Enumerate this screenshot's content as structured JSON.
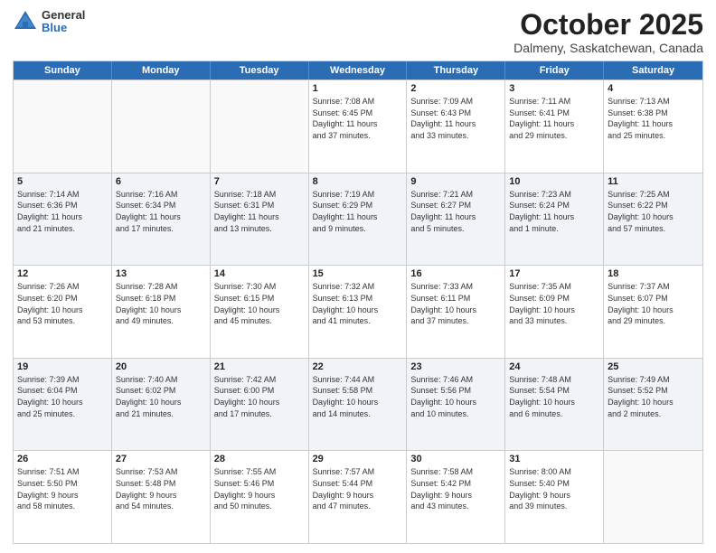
{
  "logo": {
    "general": "General",
    "blue": "Blue"
  },
  "title": "October 2025",
  "location": "Dalmeny, Saskatchewan, Canada",
  "weekdays": [
    "Sunday",
    "Monday",
    "Tuesday",
    "Wednesday",
    "Thursday",
    "Friday",
    "Saturday"
  ],
  "rows": [
    {
      "alt": false,
      "cells": [
        {
          "date": "",
          "info": ""
        },
        {
          "date": "",
          "info": ""
        },
        {
          "date": "",
          "info": ""
        },
        {
          "date": "1",
          "info": "Sunrise: 7:08 AM\nSunset: 6:45 PM\nDaylight: 11 hours\nand 37 minutes."
        },
        {
          "date": "2",
          "info": "Sunrise: 7:09 AM\nSunset: 6:43 PM\nDaylight: 11 hours\nand 33 minutes."
        },
        {
          "date": "3",
          "info": "Sunrise: 7:11 AM\nSunset: 6:41 PM\nDaylight: 11 hours\nand 29 minutes."
        },
        {
          "date": "4",
          "info": "Sunrise: 7:13 AM\nSunset: 6:38 PM\nDaylight: 11 hours\nand 25 minutes."
        }
      ]
    },
    {
      "alt": true,
      "cells": [
        {
          "date": "5",
          "info": "Sunrise: 7:14 AM\nSunset: 6:36 PM\nDaylight: 11 hours\nand 21 minutes."
        },
        {
          "date": "6",
          "info": "Sunrise: 7:16 AM\nSunset: 6:34 PM\nDaylight: 11 hours\nand 17 minutes."
        },
        {
          "date": "7",
          "info": "Sunrise: 7:18 AM\nSunset: 6:31 PM\nDaylight: 11 hours\nand 13 minutes."
        },
        {
          "date": "8",
          "info": "Sunrise: 7:19 AM\nSunset: 6:29 PM\nDaylight: 11 hours\nand 9 minutes."
        },
        {
          "date": "9",
          "info": "Sunrise: 7:21 AM\nSunset: 6:27 PM\nDaylight: 11 hours\nand 5 minutes."
        },
        {
          "date": "10",
          "info": "Sunrise: 7:23 AM\nSunset: 6:24 PM\nDaylight: 11 hours\nand 1 minute."
        },
        {
          "date": "11",
          "info": "Sunrise: 7:25 AM\nSunset: 6:22 PM\nDaylight: 10 hours\nand 57 minutes."
        }
      ]
    },
    {
      "alt": false,
      "cells": [
        {
          "date": "12",
          "info": "Sunrise: 7:26 AM\nSunset: 6:20 PM\nDaylight: 10 hours\nand 53 minutes."
        },
        {
          "date": "13",
          "info": "Sunrise: 7:28 AM\nSunset: 6:18 PM\nDaylight: 10 hours\nand 49 minutes."
        },
        {
          "date": "14",
          "info": "Sunrise: 7:30 AM\nSunset: 6:15 PM\nDaylight: 10 hours\nand 45 minutes."
        },
        {
          "date": "15",
          "info": "Sunrise: 7:32 AM\nSunset: 6:13 PM\nDaylight: 10 hours\nand 41 minutes."
        },
        {
          "date": "16",
          "info": "Sunrise: 7:33 AM\nSunset: 6:11 PM\nDaylight: 10 hours\nand 37 minutes."
        },
        {
          "date": "17",
          "info": "Sunrise: 7:35 AM\nSunset: 6:09 PM\nDaylight: 10 hours\nand 33 minutes."
        },
        {
          "date": "18",
          "info": "Sunrise: 7:37 AM\nSunset: 6:07 PM\nDaylight: 10 hours\nand 29 minutes."
        }
      ]
    },
    {
      "alt": true,
      "cells": [
        {
          "date": "19",
          "info": "Sunrise: 7:39 AM\nSunset: 6:04 PM\nDaylight: 10 hours\nand 25 minutes."
        },
        {
          "date": "20",
          "info": "Sunrise: 7:40 AM\nSunset: 6:02 PM\nDaylight: 10 hours\nand 21 minutes."
        },
        {
          "date": "21",
          "info": "Sunrise: 7:42 AM\nSunset: 6:00 PM\nDaylight: 10 hours\nand 17 minutes."
        },
        {
          "date": "22",
          "info": "Sunrise: 7:44 AM\nSunset: 5:58 PM\nDaylight: 10 hours\nand 14 minutes."
        },
        {
          "date": "23",
          "info": "Sunrise: 7:46 AM\nSunset: 5:56 PM\nDaylight: 10 hours\nand 10 minutes."
        },
        {
          "date": "24",
          "info": "Sunrise: 7:48 AM\nSunset: 5:54 PM\nDaylight: 10 hours\nand 6 minutes."
        },
        {
          "date": "25",
          "info": "Sunrise: 7:49 AM\nSunset: 5:52 PM\nDaylight: 10 hours\nand 2 minutes."
        }
      ]
    },
    {
      "alt": false,
      "cells": [
        {
          "date": "26",
          "info": "Sunrise: 7:51 AM\nSunset: 5:50 PM\nDaylight: 9 hours\nand 58 minutes."
        },
        {
          "date": "27",
          "info": "Sunrise: 7:53 AM\nSunset: 5:48 PM\nDaylight: 9 hours\nand 54 minutes."
        },
        {
          "date": "28",
          "info": "Sunrise: 7:55 AM\nSunset: 5:46 PM\nDaylight: 9 hours\nand 50 minutes."
        },
        {
          "date": "29",
          "info": "Sunrise: 7:57 AM\nSunset: 5:44 PM\nDaylight: 9 hours\nand 47 minutes."
        },
        {
          "date": "30",
          "info": "Sunrise: 7:58 AM\nSunset: 5:42 PM\nDaylight: 9 hours\nand 43 minutes."
        },
        {
          "date": "31",
          "info": "Sunrise: 8:00 AM\nSunset: 5:40 PM\nDaylight: 9 hours\nand 39 minutes."
        },
        {
          "date": "",
          "info": ""
        }
      ]
    }
  ]
}
